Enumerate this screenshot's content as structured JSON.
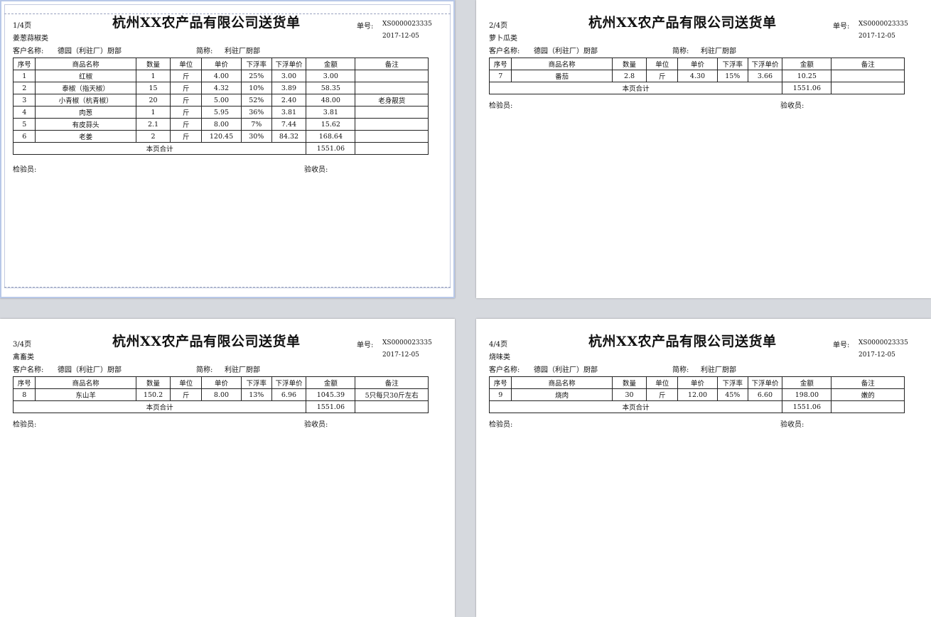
{
  "doc": {
    "title": "杭州XX农产品有限公司送货单",
    "dan_label": "单号:",
    "dan_value": "XS0000023335",
    "date": "2017-12-05",
    "cust_label": "客户名称:",
    "cust_value": "德园（利驻厂）厨部",
    "short_label": "简称:",
    "short_value": "利驻厂厨部",
    "headers": [
      "序号",
      "商品名称",
      "数量",
      "单位",
      "单价",
      "下浮率",
      "下浮单价",
      "金额",
      "备注"
    ],
    "subtotal_label": "本页合计",
    "subtotal_value": "1551.06",
    "inspector_label": "检验员:",
    "receiver_label": "验收员:"
  },
  "pages": [
    {
      "page_no": "1/4页",
      "category": "姜葱蒜椒类",
      "rows": [
        [
          "1",
          "红椒",
          "1",
          "斤",
          "4.00",
          "25%",
          "3.00",
          "3.00",
          ""
        ],
        [
          "2",
          "泰椒（指天椒）",
          "15",
          "斤",
          "4.32",
          "10%",
          "3.89",
          "58.35",
          ""
        ],
        [
          "3",
          "小青椒（杭青椒）",
          "20",
          "斤",
          "5.00",
          "52%",
          "2.40",
          "48.00",
          "老身靓货"
        ],
        [
          "4",
          "肉葱",
          "1",
          "斤",
          "5.95",
          "36%",
          "3.81",
          "3.81",
          ""
        ],
        [
          "5",
          "有皮蒜头",
          "2.1",
          "斤",
          "8.00",
          "7%",
          "7.44",
          "15.62",
          ""
        ],
        [
          "6",
          "老姜",
          "2",
          "斤",
          "120.45",
          "30%",
          "84.32",
          "168.64",
          ""
        ]
      ]
    },
    {
      "page_no": "2/4页",
      "category": "萝卜瓜类",
      "rows": [
        [
          "7",
          "番茄",
          "2.8",
          "斤",
          "4.30",
          "15%",
          "3.66",
          "10.25",
          ""
        ]
      ]
    },
    {
      "page_no": "3/4页",
      "category": "禽畜类",
      "rows": [
        [
          "8",
          "东山羊",
          "150.2",
          "斤",
          "8.00",
          "13%",
          "6.96",
          "1045.39",
          "5只每只30斤左右"
        ]
      ]
    },
    {
      "page_no": "4/4页",
      "category": "烧味类",
      "rows": [
        [
          "9",
          "烧肉",
          "30",
          "斤",
          "12.00",
          "45%",
          "6.60",
          "198.00",
          "嫩的"
        ]
      ]
    }
  ]
}
